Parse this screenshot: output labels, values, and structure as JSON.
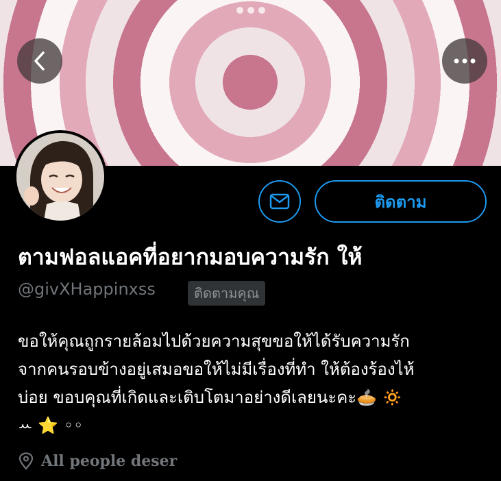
{
  "header": {
    "back_icon": "chevron-left-icon",
    "more_icon": "ellipsis-icon"
  },
  "profile": {
    "display_name": "ตามฟอลแอคที่อยากมอบความรัก ให้",
    "handle": "@givXHappinxss",
    "follows_you_badge": "ติดตามคุณ",
    "follow_button_label": "ติดตาม",
    "message_icon": "mail-icon",
    "bio_lines": [
      "ขอให้คุณถูกรายล้อมไปด้วยความสุขขอให้ได้รับความรัก",
      "จากคนรอบข้างอยู่เสมอขอให้ไม่มีเรื่องที่ทำ ให้ต้องร้องไห้",
      "บ่อย ขอบคุณที่เกิดและเติบโตมาอย่างดีเลยนะคะ🥧 🔅",
      "ꕀ ⭐️ ◦◦"
    ],
    "location": "All people deser",
    "location_icon": "location-pin-icon"
  },
  "colors": {
    "accent": "#1d9bf0",
    "secondary_text": "#71767b",
    "background": "#000000"
  }
}
